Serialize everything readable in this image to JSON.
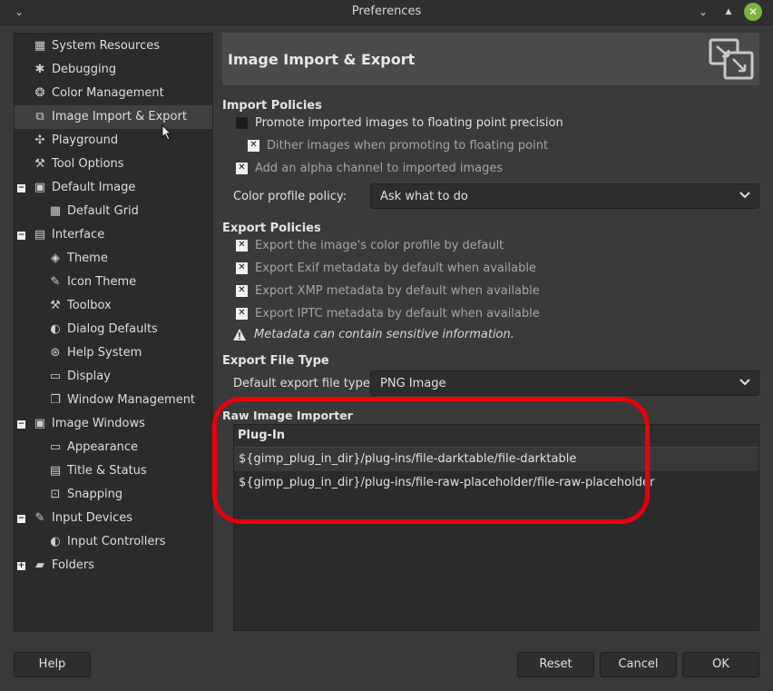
{
  "window": {
    "title": "Preferences"
  },
  "sidebar": {
    "items": [
      {
        "label": "System Resources",
        "icon": "chip-icon"
      },
      {
        "label": "Debugging",
        "icon": "bug-icon"
      },
      {
        "label": "Color Management",
        "icon": "color-circles-icon"
      },
      {
        "label": "Image Import & Export",
        "icon": "image-import-export-icon"
      },
      {
        "label": "Playground",
        "icon": "pinwheel-icon"
      },
      {
        "label": "Tool Options",
        "icon": "tool-options-icon"
      },
      {
        "label": "Default Image",
        "icon": "default-image-icon"
      },
      {
        "label": "Default Grid",
        "icon": "grid-icon"
      },
      {
        "label": "Interface",
        "icon": "interface-icon"
      },
      {
        "label": "Theme",
        "icon": "theme-icon"
      },
      {
        "label": "Icon Theme",
        "icon": "icon-theme-icon"
      },
      {
        "label": "Toolbox",
        "icon": "toolbox-icon"
      },
      {
        "label": "Dialog Defaults",
        "icon": "dialog-defaults-icon"
      },
      {
        "label": "Help System",
        "icon": "lifebuoy-icon"
      },
      {
        "label": "Display",
        "icon": "display-icon"
      },
      {
        "label": "Window Management",
        "icon": "window-management-icon"
      },
      {
        "label": "Image Windows",
        "icon": "image-windows-icon"
      },
      {
        "label": "Appearance",
        "icon": "appearance-icon"
      },
      {
        "label": "Title & Status",
        "icon": "title-status-icon"
      },
      {
        "label": "Snapping",
        "icon": "snapping-icon"
      },
      {
        "label": "Input Devices",
        "icon": "input-devices-icon"
      },
      {
        "label": "Input Controllers",
        "icon": "input-controllers-icon"
      },
      {
        "label": "Folders",
        "icon": "folders-icon"
      }
    ],
    "selected": "Image Import & Export"
  },
  "header": {
    "title": "Image Import & Export"
  },
  "import_policies": {
    "title": "Import Policies",
    "promote": {
      "label": "Promote imported images to floating point precision",
      "checked": false
    },
    "dither": {
      "label": "Dither images when promoting to floating point",
      "checked": true
    },
    "alpha": {
      "label": "Add an alpha channel to imported images",
      "checked": true
    },
    "color_profile_policy_label": "Color profile policy:",
    "color_profile_policy_value": "Ask what to do"
  },
  "export_policies": {
    "title": "Export Policies",
    "color_profile": {
      "label": "Export the image's color profile by default",
      "checked": true
    },
    "exif": {
      "label": "Export Exif metadata by default when available",
      "checked": true
    },
    "xmp": {
      "label": "Export XMP metadata by default when available",
      "checked": true
    },
    "iptc": {
      "label": "Export IPTC metadata by default when available",
      "checked": true
    },
    "warning": "Metadata can contain sensitive information."
  },
  "export_file_type": {
    "title": "Export File Type",
    "label": "Default export file type:",
    "value": "PNG Image"
  },
  "raw_importer": {
    "title": "Raw Image Importer",
    "column": "Plug-In",
    "rows": [
      "${gimp_plug_in_dir}/plug-ins/file-darktable/file-darktable",
      "${gimp_plug_in_dir}/plug-ins/file-raw-placeholder/file-raw-placeholder"
    ]
  },
  "buttons": {
    "help": "Help",
    "reset": "Reset",
    "cancel": "Cancel",
    "ok": "OK"
  },
  "colors": {
    "highlight": "#e8000a",
    "close_button": "#7cb342"
  }
}
